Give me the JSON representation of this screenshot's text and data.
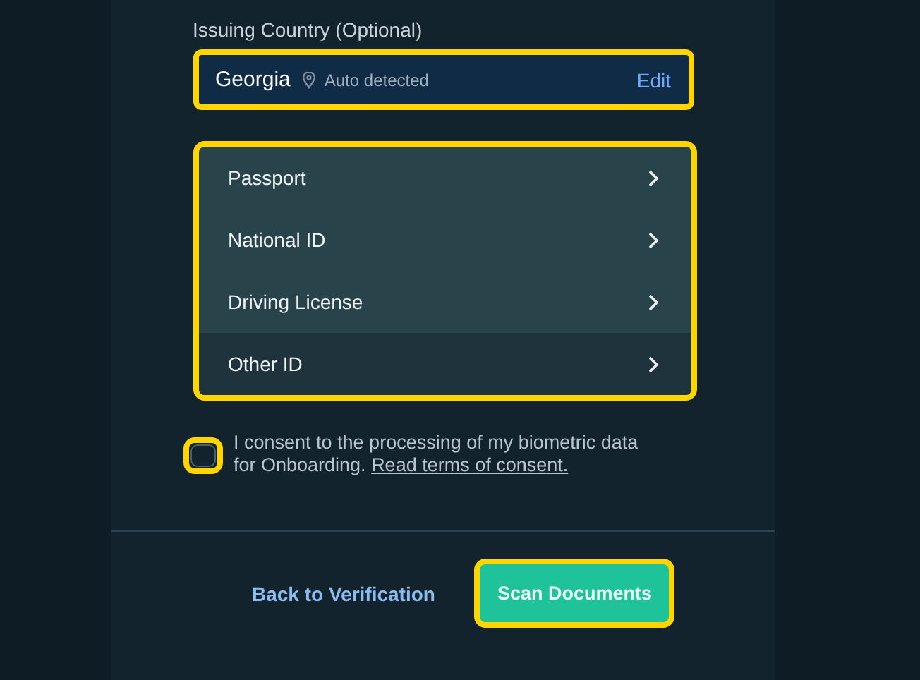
{
  "country": {
    "label": "Issuing Country (Optional)",
    "value": "Georgia",
    "hint": "Auto detected",
    "action": "Edit",
    "highlighted": true
  },
  "documents": {
    "highlighted": true,
    "items": [
      {
        "label": "Passport",
        "selected": false
      },
      {
        "label": "National ID",
        "selected": false
      },
      {
        "label": "Driving License",
        "selected": false
      },
      {
        "label": "Other ID",
        "selected": true
      }
    ]
  },
  "consent": {
    "checked": false,
    "highlighted": true,
    "text": "I consent to the processing of my biometric data for Onboarding.",
    "link": "Read terms of consent."
  },
  "footer": {
    "back": "Back to Verification",
    "primary": "Scan Documents",
    "primary_highlighted": true
  }
}
